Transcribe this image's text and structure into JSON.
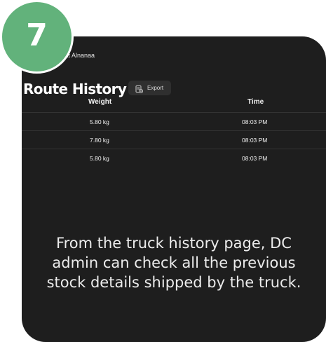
{
  "step": {
    "number": "7",
    "badge_color": "#62b27b"
  },
  "header": {
    "user_name": "wat Alnanaa"
  },
  "page": {
    "title": "Route History"
  },
  "toolbar": {
    "export_label": "Export",
    "export_icon": "export-icon"
  },
  "table": {
    "columns": {
      "weight": "Weight",
      "time": "Time"
    },
    "rows": [
      {
        "weight": "5.80 kg",
        "time": "08:03 PM"
      },
      {
        "weight": "7.80 kg",
        "time": "08:03 PM"
      },
      {
        "weight": "5.80 kg",
        "time": "08:03 PM"
      }
    ]
  },
  "caption": {
    "lines": [
      "From the truck history page, DC",
      "admin can check all the previous",
      "stock details shipped by the truck."
    ]
  },
  "colors": {
    "background": "#1e1e1e",
    "accent": "#62b27b"
  }
}
